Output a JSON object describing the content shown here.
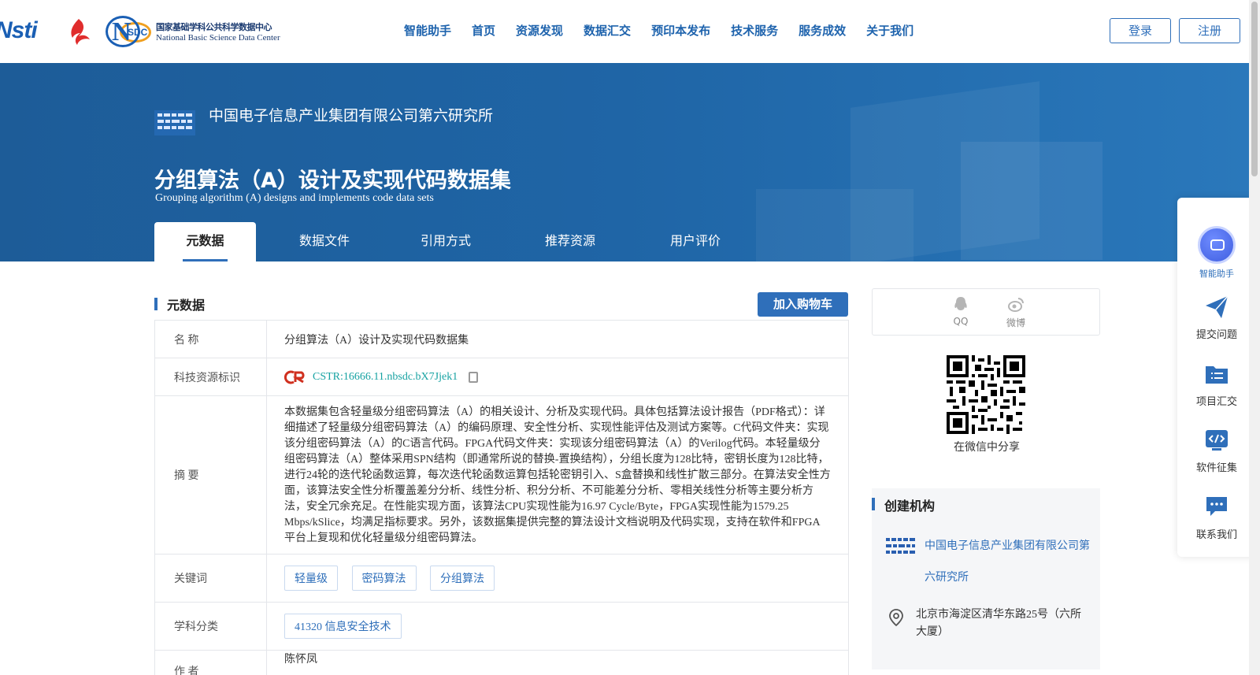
{
  "header": {
    "logo_nsti": "Nsti",
    "logo_nsdc_cn": "国家基础学科公共科学数据中心",
    "logo_nsdc_en": "National Basic Science Data Center",
    "nav": [
      "智能助手",
      "首页",
      "资源发现",
      "数据汇交",
      "预印本发布",
      "技术服务",
      "服务成效",
      "关于我们"
    ],
    "login": "登录",
    "register": "注册"
  },
  "banner": {
    "org_name": "中国电子信息产业集团有限公司第六研究所",
    "title": "分组算法（A）设计及实现代码数据集",
    "subtitle": "Grouping algorithm (A) designs and implements code data sets",
    "tabs": [
      "元数据",
      "数据文件",
      "引用方式",
      "推荐资源",
      "用户评价"
    ]
  },
  "metadata": {
    "section_title": "元数据",
    "cart_button": "加入购物车",
    "rows": {
      "name_label": "名   称",
      "name_value": "分组算法（A）设计及实现代码数据集",
      "cstr_label": "科技资源标识",
      "cstr_value": "CSTR:16666.11.nbsdc.bX7Jjek1",
      "abstract_label": "摘   要",
      "abstract_value": "本数据集包含轻量级分组密码算法（A）的相关设计、分析及实现代码。具体包括算法设计报告（PDF格式）：详细描述了轻量级分组密码算法（A）的编码原理、安全性分析、实现性能评估及测试方案等。C代码文件夹：实现该分组密码算法（A）的C语言代码。FPGA代码文件夹：实现该分组密码算法（A）的Verilog代码。本轻量级分组密码算法（A）整体采用SPN结构（即通常所说的替换-置换结构），分组长度为128比特，密钥长度为128比特，进行24轮的迭代轮函数运算，每次迭代轮函数运算包括轮密钥引入、S盒替换和线性扩散三部分。在算法安全性方面，该算法安全性分析覆盖差分分析、线性分析、积分分析、不可能差分分析、零相关线性分析等主要分析方法，安全冗余充足。在性能实现方面，该算法CPU实现性能为16.97 Cycle/Byte，FPGA实现性能为1579.25 Mbps/kSlice，均满足指标要求。另外，该数据集提供完整的算法设计文档说明及代码实现，支持在软件和FPGA平台上复现和优化轻量级分组密码算法。",
      "keywords_label": "关键词",
      "keywords": [
        "轻量级",
        "密码算法",
        "分组算法"
      ],
      "subject_label": "学科分类",
      "subject_value": "41320 信息安全技术",
      "author_label": "作   者",
      "author_value": "陈怀凤"
    }
  },
  "share": {
    "qq": "QQ",
    "weibo": "微博",
    "wechat_caption": "在微信中分享"
  },
  "creator": {
    "title": "创建机构",
    "org_name": "中国电子信息产业集团有限公司第六研究所",
    "address": "北京市海淀区清华东路25号（六所大厦）"
  },
  "float_panel": {
    "items": [
      "智能助手",
      "提交问题",
      "项目汇交",
      "软件征集",
      "联系我们"
    ]
  },
  "colors": {
    "primary": "#2f6fba",
    "banner": "#1f65a6",
    "link": "#16a2a2"
  }
}
